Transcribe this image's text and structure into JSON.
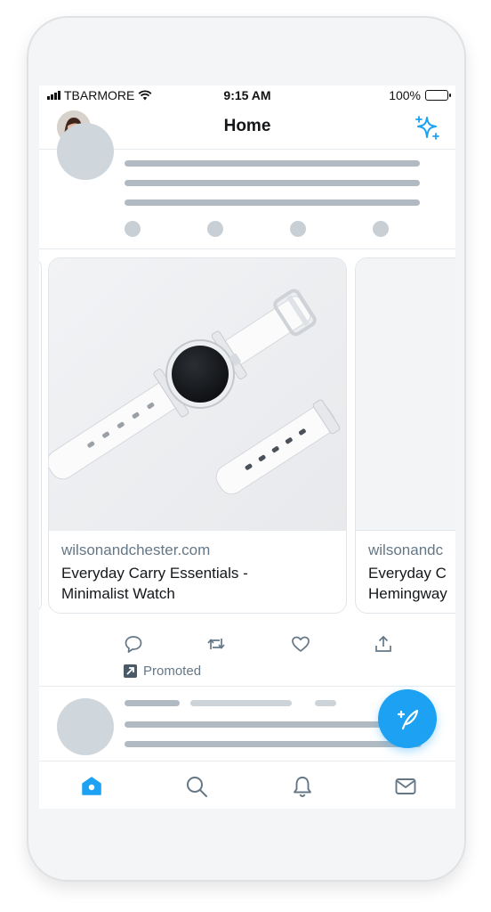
{
  "status_bar": {
    "carrier": "TBARMORE",
    "time": "9:15 AM",
    "battery": "100%"
  },
  "header": {
    "title": "Home",
    "profile_icon": "profile-avatar",
    "sparkle_icon": "sparkle-icon"
  },
  "cards": [
    {
      "domain": "wilsonandchester.com",
      "title_line1": "Everyday Carry Essentials -",
      "title_line2": "Minimalist Watch"
    },
    {
      "domain": "wilsonandc",
      "title_line1": "Everyday C",
      "title_line2": "Hemingway"
    }
  ],
  "actions": {
    "reply_icon": "reply-icon",
    "retweet_icon": "retweet-icon",
    "like_icon": "like-icon",
    "share_icon": "share-icon"
  },
  "promoted_label": "Promoted",
  "fab": {
    "icon": "compose-tweet-icon"
  },
  "tabs": [
    "home-icon",
    "search-icon",
    "notifications-icon",
    "messages-icon"
  ],
  "colors": {
    "accent": "#1da1f2",
    "skeleton": "#b1bac2",
    "muted_text": "#657786"
  }
}
